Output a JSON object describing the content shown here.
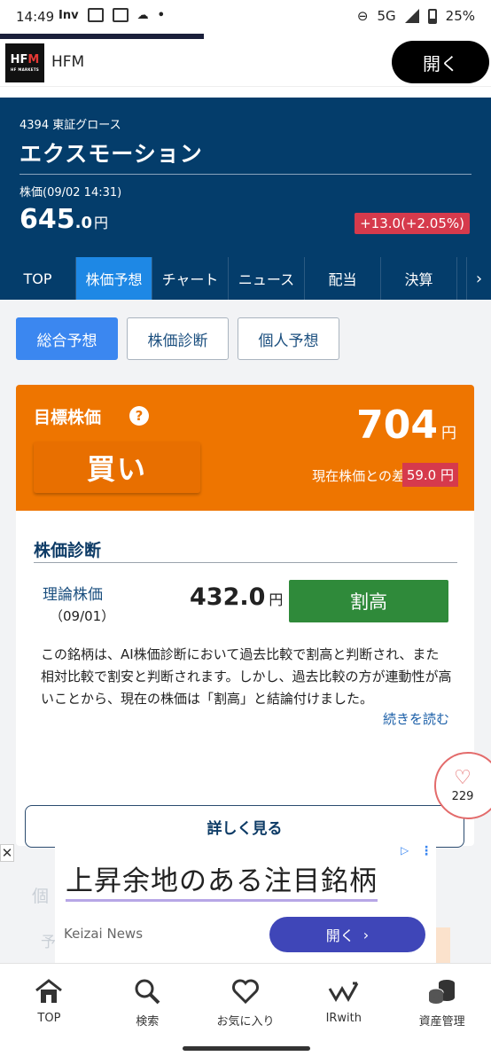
{
  "status_bar": {
    "time": "14:49",
    "notif_text": "Inv",
    "network": "5G",
    "battery": "25%"
  },
  "ad_top": {
    "logo_text_a": "HF",
    "logo_text_b": "M",
    "logo_sub": "HF MARKETS",
    "name": "HFM",
    "open_label": "開く"
  },
  "stock": {
    "code_market": "4394 東証グロース",
    "name": "エクスモーション",
    "price_time": "株価(09/02 14:31)",
    "price_int": "645",
    "price_dec": ".0",
    "price_unit": "円",
    "change": "+13.0(+2.05%)",
    "change_color": "#d63a4c"
  },
  "tabs": [
    {
      "label": "TOP"
    },
    {
      "label": "株価予想",
      "active": true
    },
    {
      "label": "チャート"
    },
    {
      "label": "ニュース"
    },
    {
      "label": "配当"
    },
    {
      "label": "決算"
    }
  ],
  "tab_next_icon": "chevron-right-icon",
  "subtabs": [
    {
      "label": "総合予想",
      "active": true
    },
    {
      "label": "株価診断"
    },
    {
      "label": "個人予想"
    }
  ],
  "target": {
    "label": "目標株価",
    "help": "?",
    "rating": "買い",
    "price": "704",
    "unit": "円",
    "diff_label": "現在株価との差",
    "diff_value": "59.0 円",
    "bg_color": "#ee7500"
  },
  "diagnosis": {
    "title": "株価診断",
    "theory_label": "理論株価",
    "theory_date": "（09/01）",
    "theory_price": "432.0",
    "unit": "円",
    "verdict": "割高",
    "verdict_color": "#2f8a3a",
    "text": "この銘柄は、AI株価診断において過去比較で割高と判断され、また相対比較で割安と判断されます。しかし、過去比較の方が連動性が高いことから、現在の株価は「割高」と結論付けました。",
    "read_more": "続きを読む",
    "more_button": "詳しく見る"
  },
  "like": {
    "icon": "heart-icon",
    "count": "229"
  },
  "ad_bottom": {
    "close": "✕",
    "headline": "上昇余地のある注目銘柄",
    "brand": "Keizai News",
    "open_label": "開く",
    "ghost_text_1": "個",
    "ghost_text_2": "予"
  },
  "bottom_nav": [
    {
      "label": "TOP",
      "icon": "home-icon"
    },
    {
      "label": "検索",
      "icon": "search-icon"
    },
    {
      "label": "お気に入り",
      "icon": "heart-icon"
    },
    {
      "label": "IRwith",
      "icon": "irwith-icon"
    },
    {
      "label": "資産管理",
      "icon": "coins-icon"
    }
  ]
}
